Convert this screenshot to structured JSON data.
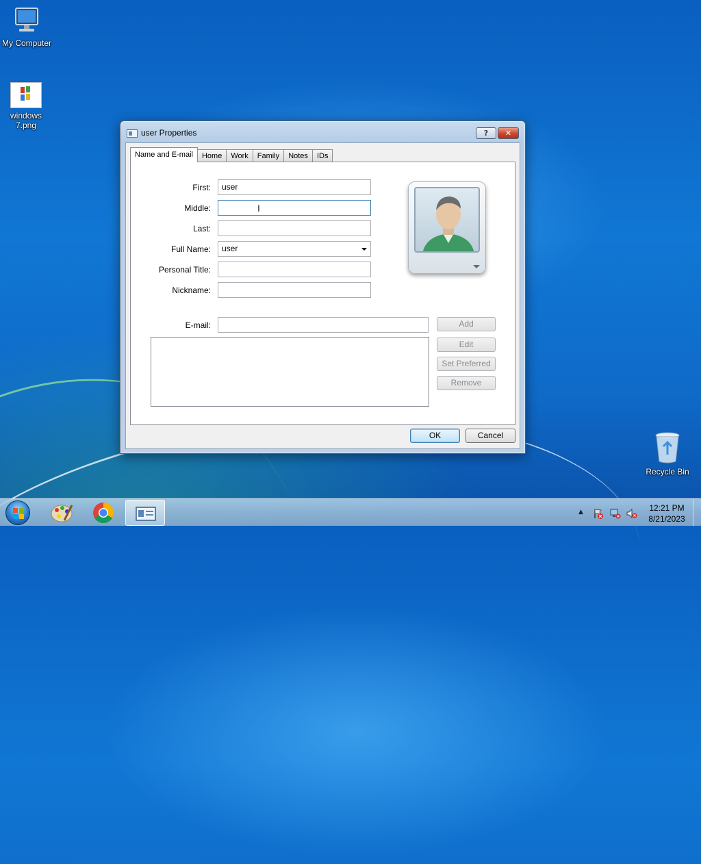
{
  "desktop": {
    "icons": [
      {
        "label": "My Computer"
      },
      {
        "label": "windows\n7.png"
      },
      {
        "label": "Recycle Bin"
      }
    ]
  },
  "dialog": {
    "title": "user Properties",
    "help_label": "?",
    "close_label": "✕",
    "tabs": [
      {
        "label": "Name and E-mail",
        "active": true
      },
      {
        "label": "Home"
      },
      {
        "label": "Work"
      },
      {
        "label": "Family"
      },
      {
        "label": "Notes"
      },
      {
        "label": "IDs"
      }
    ],
    "fields": {
      "first": {
        "label": "First:",
        "value": "user"
      },
      "middle": {
        "label": "Middle:",
        "value": ""
      },
      "last": {
        "label": "Last:",
        "value": ""
      },
      "full_name": {
        "label": "Full Name:",
        "value": "user"
      },
      "personal_title": {
        "label": "Personal Title:",
        "value": ""
      },
      "nickname": {
        "label": "Nickname:",
        "value": ""
      },
      "email": {
        "label": "E-mail:",
        "value": ""
      }
    },
    "email_buttons": {
      "add": "Add",
      "edit": "Edit",
      "set_preferred": "Set Preferred",
      "remove": "Remove"
    },
    "ok_label": "OK",
    "cancel_label": "Cancel"
  },
  "taskbar": {
    "time": "12:21 PM",
    "date": "8/21/2023",
    "tray_expand": "▲"
  },
  "colors": {
    "desktop_blue": "#1177d4",
    "window_frame": "#bcd1e8",
    "close_red": "#c9462c",
    "focus_blue": "#3c7fb1"
  }
}
